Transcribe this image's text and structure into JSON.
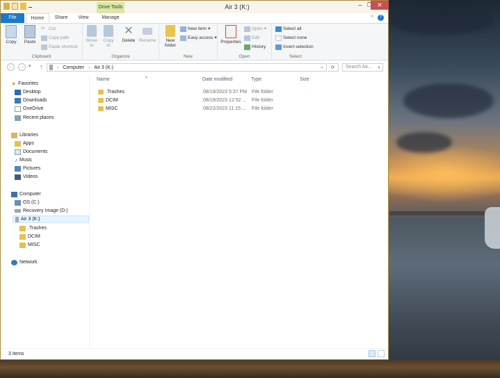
{
  "window": {
    "title": "Air 3 (K:)",
    "context_tab": "Drive Tools",
    "controls": {
      "minimize": "–",
      "maximize": "❐",
      "close": "✕"
    }
  },
  "tabs": [
    "File",
    "Home",
    "Share",
    "View",
    "Manage"
  ],
  "ribbon": {
    "clipboard": {
      "label": "Clipboard",
      "copy": "Copy",
      "paste": "Paste",
      "cut": "Cut",
      "copy_path": "Copy path",
      "paste_shortcut": "Paste shortcut"
    },
    "organize": {
      "label": "Organize",
      "move_to": "Move to",
      "copy_to": "Copy to",
      "delete": "Delete",
      "rename": "Rename"
    },
    "new": {
      "label": "New",
      "new_folder": "New folder",
      "new_item": "New item",
      "easy_access": "Easy access"
    },
    "open": {
      "label": "Open",
      "properties": "Properties",
      "open": "Open",
      "edit": "Edit",
      "history": "History"
    },
    "select": {
      "label": "Select",
      "select_all": "Select all",
      "select_none": "Select none",
      "invert_selection": "Invert selection"
    }
  },
  "address": {
    "crumbs": [
      "Computer",
      "Air 3 (K:)"
    ],
    "search_placeholder": "Search Air..."
  },
  "nav": {
    "favorites": {
      "label": "Favorites",
      "items": [
        "Desktop",
        "Downloads",
        "OneDrive",
        "Recent places"
      ]
    },
    "libraries": {
      "label": "Libraries",
      "items": [
        "Apps",
        "Documents",
        "Music",
        "Pictures",
        "Videos"
      ]
    },
    "computer": {
      "label": "Computer",
      "items": [
        "OS (C:)",
        "Recovery Image (D:)",
        "Air 3 (K:)"
      ],
      "subitems": [
        ".Trashes",
        "DCIM",
        "MISC"
      ]
    },
    "network": {
      "label": "Network"
    }
  },
  "columns": {
    "name": "Name",
    "date": "Date modified",
    "type": "Type",
    "size": "Size"
  },
  "files": [
    {
      "name": ".Trashes",
      "date": "08/19/2023 5:37 PM",
      "type": "File folder"
    },
    {
      "name": "DCIM",
      "date": "08/19/2023 12:52 ...",
      "type": "File folder"
    },
    {
      "name": "MISC",
      "date": "08/22/2023 11:15 ...",
      "type": "File folder"
    }
  ],
  "status": {
    "items": "3 items"
  },
  "colors": {
    "accent": "#1979ca",
    "frame": "#a88a3b",
    "context_tab": "#d9e8a3",
    "folder": "#e6c04f"
  }
}
